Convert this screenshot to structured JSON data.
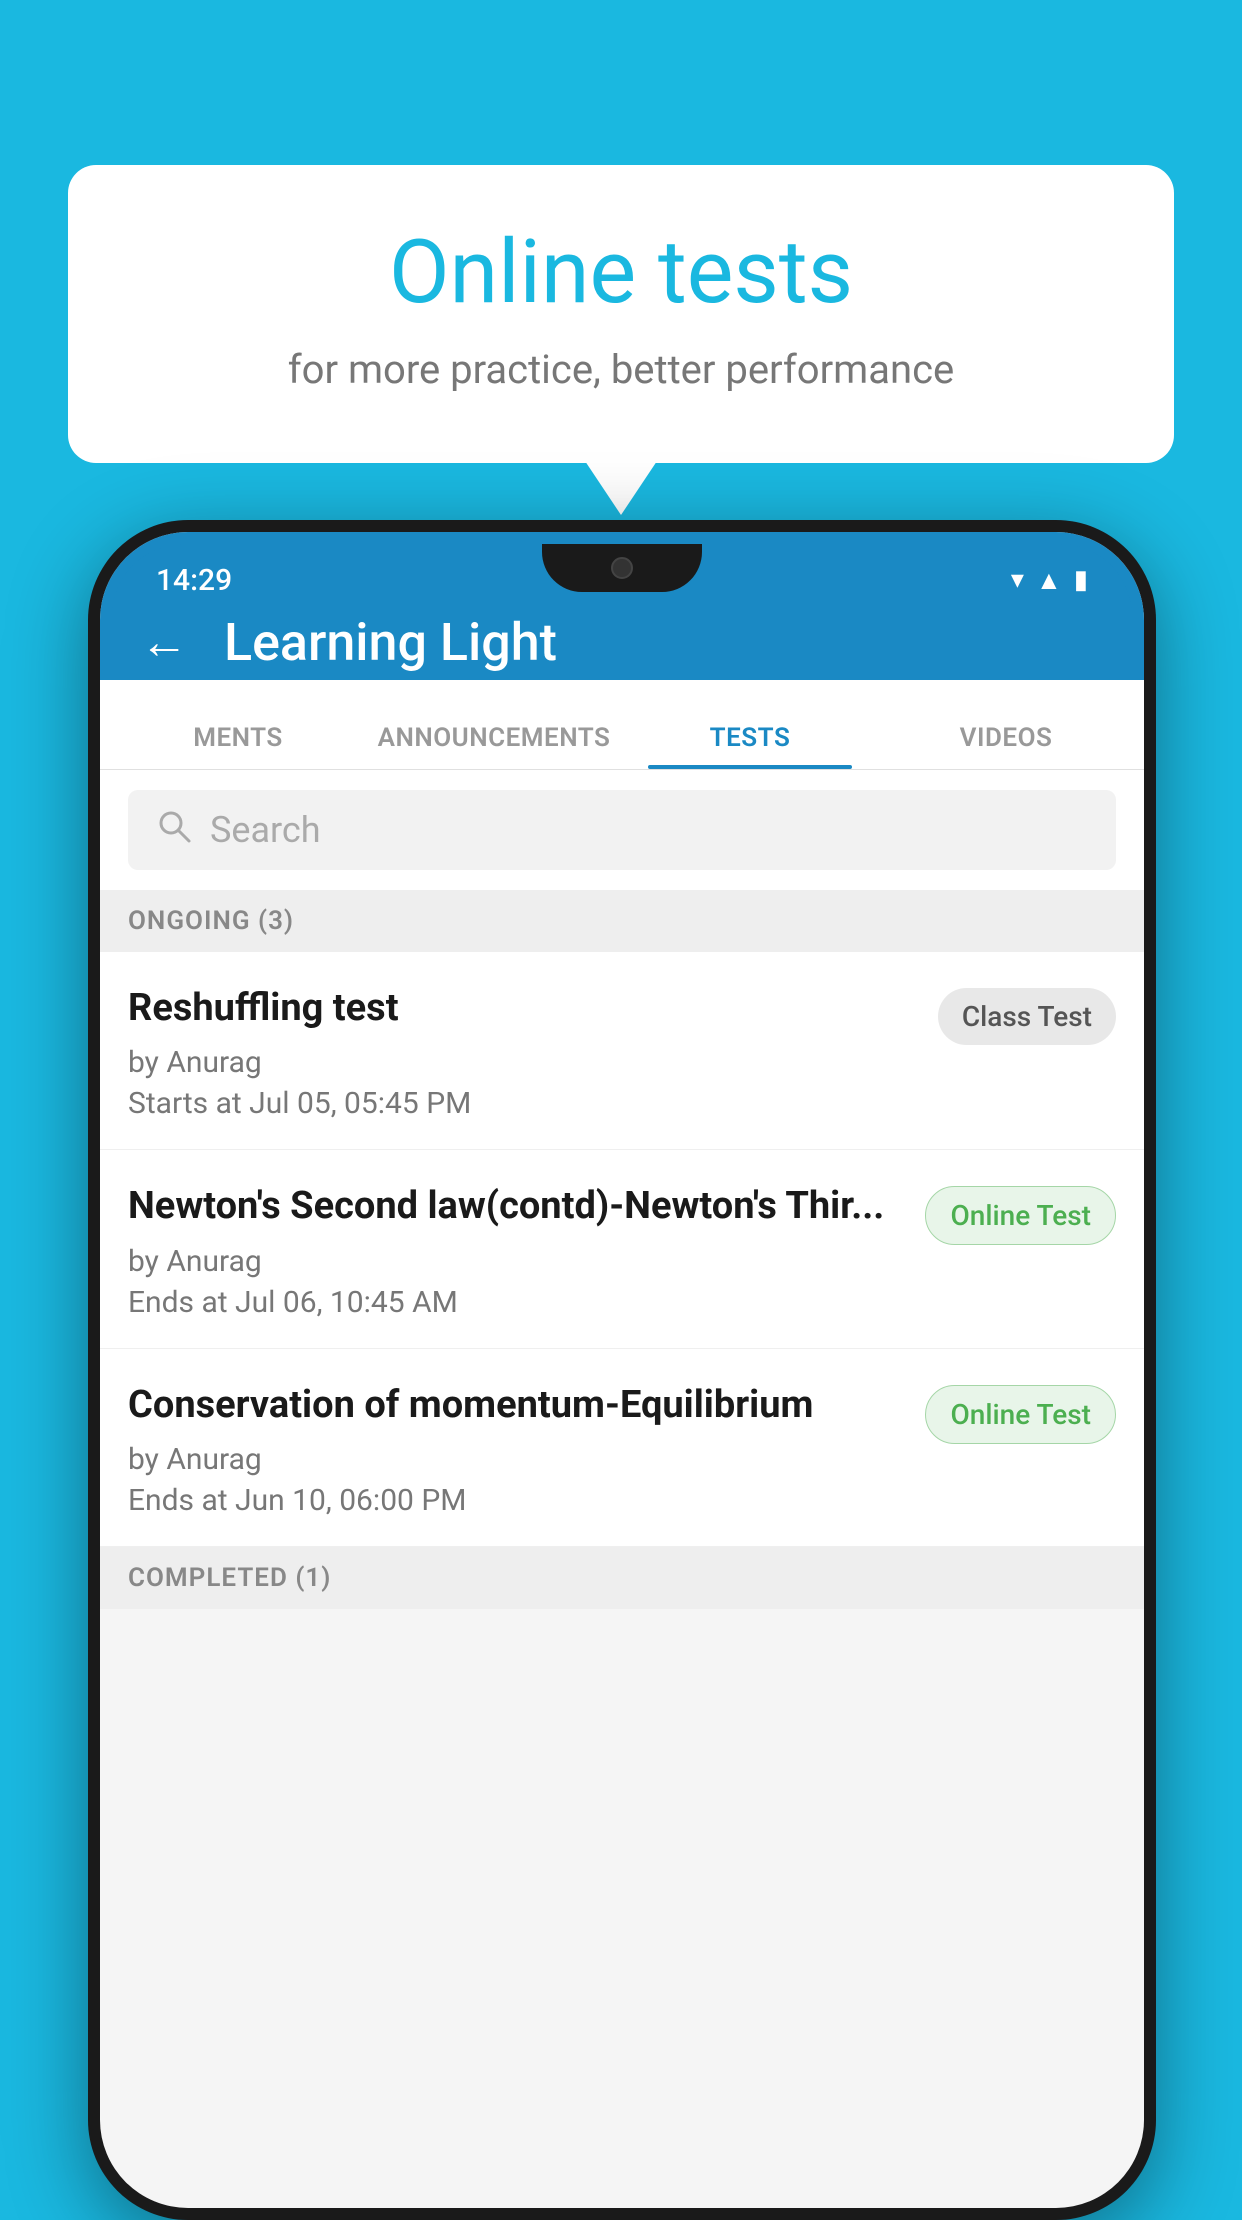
{
  "background": {
    "color": "#1ab8e0"
  },
  "bubble": {
    "title": "Online tests",
    "subtitle": "for more practice, better performance"
  },
  "phone": {
    "statusBar": {
      "time": "14:29",
      "icons": [
        "wifi",
        "signal",
        "battery"
      ]
    },
    "header": {
      "backLabel": "←",
      "title": "Learning Light"
    },
    "tabs": [
      {
        "label": "MENTS",
        "active": false
      },
      {
        "label": "ANNOUNCEMENTS",
        "active": false
      },
      {
        "label": "TESTS",
        "active": true
      },
      {
        "label": "VIDEOS",
        "active": false
      }
    ],
    "search": {
      "placeholder": "Search"
    },
    "ongoingSection": {
      "label": "ONGOING (3)",
      "items": [
        {
          "title": "Reshuffling test",
          "by": "by Anurag",
          "date": "Starts at  Jul 05, 05:45 PM",
          "badge": "Class Test",
          "badgeType": "class"
        },
        {
          "title": "Newton's Second law(contd)-Newton's Thir...",
          "by": "by Anurag",
          "date": "Ends at  Jul 06, 10:45 AM",
          "badge": "Online Test",
          "badgeType": "online"
        },
        {
          "title": "Conservation of momentum-Equilibrium",
          "by": "by Anurag",
          "date": "Ends at  Jun 10, 06:00 PM",
          "badge": "Online Test",
          "badgeType": "online"
        }
      ]
    },
    "completedSection": {
      "label": "COMPLETED (1)"
    }
  }
}
